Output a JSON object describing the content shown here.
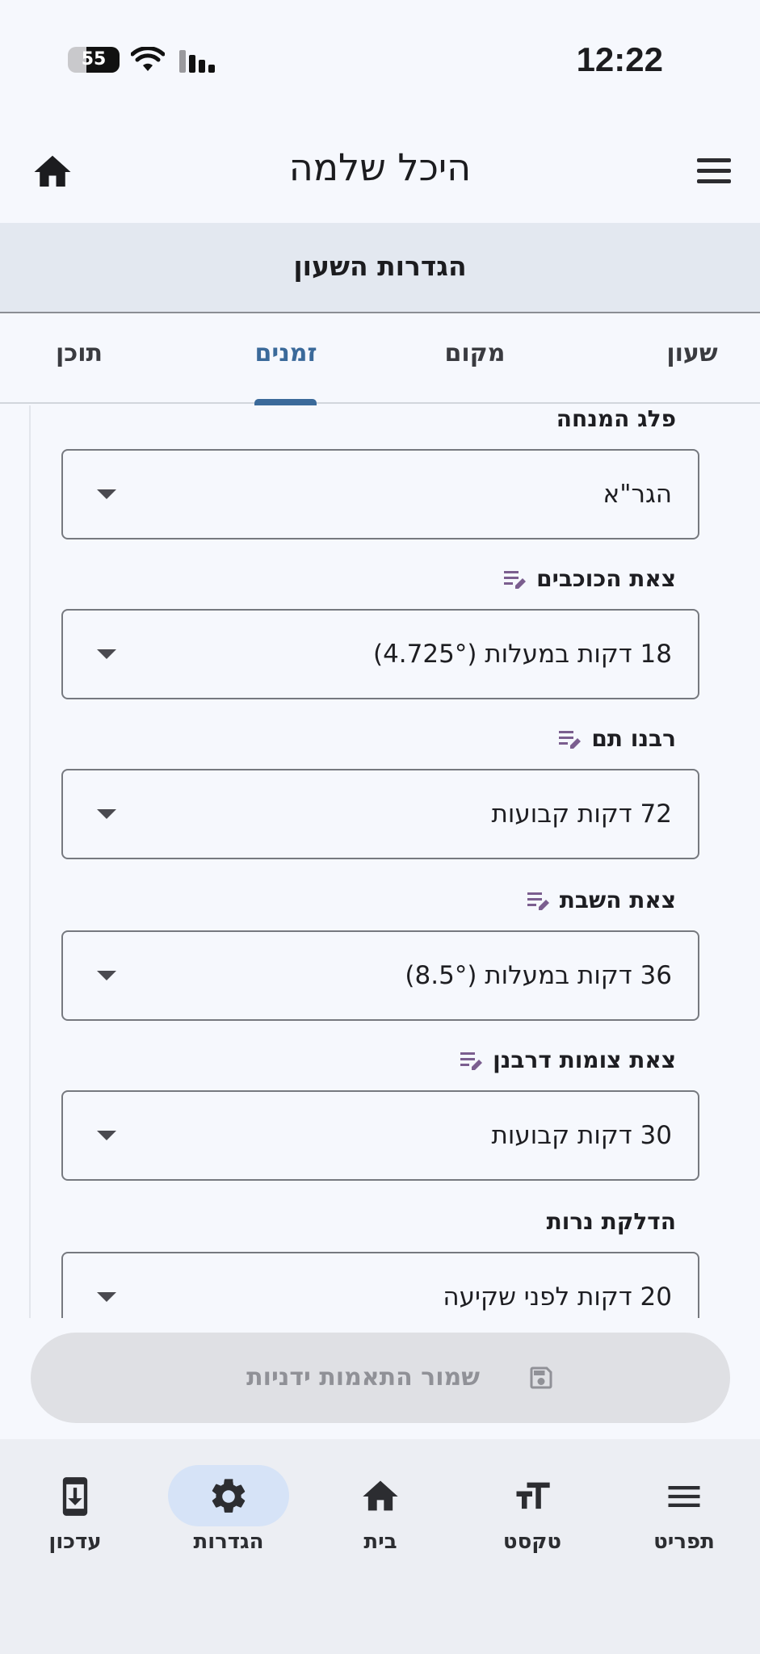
{
  "status_bar": {
    "time": "12:22",
    "battery_level": "55"
  },
  "app_bar": {
    "title": "היכל שלמה"
  },
  "settings_header": {
    "title": "הגדרות השעון"
  },
  "tabs": [
    {
      "label": "שעון",
      "active": false
    },
    {
      "label": "מקום",
      "active": false
    },
    {
      "label": "זמנים",
      "active": true
    },
    {
      "label": "תוכן",
      "active": false
    }
  ],
  "fields": [
    {
      "label": "פלג המנחה",
      "value": "הגר\"א",
      "editable": false
    },
    {
      "label": "צאת הכוכבים",
      "value": "18 דקות במעלות (4.725°)",
      "editable": true
    },
    {
      "label": "רבנו תם",
      "value": "72 דקות קבועות",
      "editable": true
    },
    {
      "label": "צאת השבת",
      "value": "36 דקות במעלות (8.5°)",
      "editable": true
    },
    {
      "label": "צאת צומות דרבנן",
      "value": "30 דקות קבועות",
      "editable": true
    },
    {
      "label": "הדלקת נרות",
      "value": "20 דקות לפני שקיעה",
      "editable": false
    }
  ],
  "save_button": {
    "label": "שמור התאמות ידניות",
    "icon": "save-icon"
  },
  "bottom_nav": [
    {
      "label": "עדכון",
      "icon": "update-icon",
      "active": false
    },
    {
      "label": "הגדרות",
      "icon": "gear-icon",
      "active": true
    },
    {
      "label": "בית",
      "icon": "home-icon",
      "active": false
    },
    {
      "label": "טקסט",
      "icon": "text-size-icon",
      "active": false
    },
    {
      "label": "תפריט",
      "icon": "menu-icon",
      "active": false
    }
  ],
  "colors": {
    "accent": "#3b6a9a",
    "header_bg": "#e3e8f0",
    "nav_active_bg": "#d6e3f7",
    "edit_icon": "#7b5e8f"
  }
}
